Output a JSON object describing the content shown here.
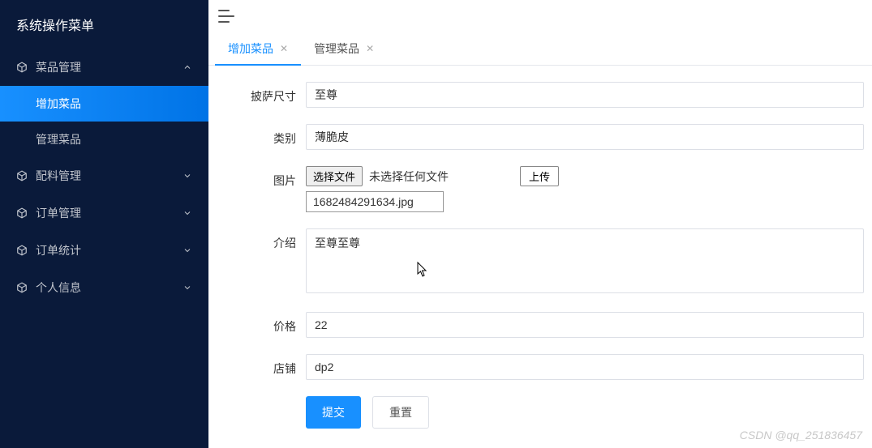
{
  "sidebar": {
    "title": "系统操作菜单",
    "items": [
      {
        "label": "菜品管理",
        "expanded": true,
        "children": [
          {
            "label": "增加菜品",
            "active": true
          },
          {
            "label": "管理菜品",
            "active": false
          }
        ]
      },
      {
        "label": "配料管理",
        "expanded": false
      },
      {
        "label": "订单管理",
        "expanded": false
      },
      {
        "label": "订单统计",
        "expanded": false
      },
      {
        "label": "个人信息",
        "expanded": false
      }
    ]
  },
  "tabs": [
    {
      "label": "增加菜品",
      "active": true
    },
    {
      "label": "管理菜品",
      "active": false
    }
  ],
  "form": {
    "pizza_size": {
      "label": "披萨尺寸",
      "value": "至尊"
    },
    "category": {
      "label": "类别",
      "value": "薄脆皮"
    },
    "image": {
      "label": "图片",
      "choose_file_btn": "选择文件",
      "no_file_text": "未选择任何文件",
      "upload_btn": "上传",
      "filename": "1682484291634.jpg"
    },
    "intro": {
      "label": "介绍",
      "value": "至尊至尊"
    },
    "price": {
      "label": "价格",
      "value": "22"
    },
    "shop": {
      "label": "店铺",
      "value": "dp2"
    },
    "submit_btn": "提交",
    "reset_btn": "重置"
  },
  "watermark": "CSDN @qq_251836457"
}
